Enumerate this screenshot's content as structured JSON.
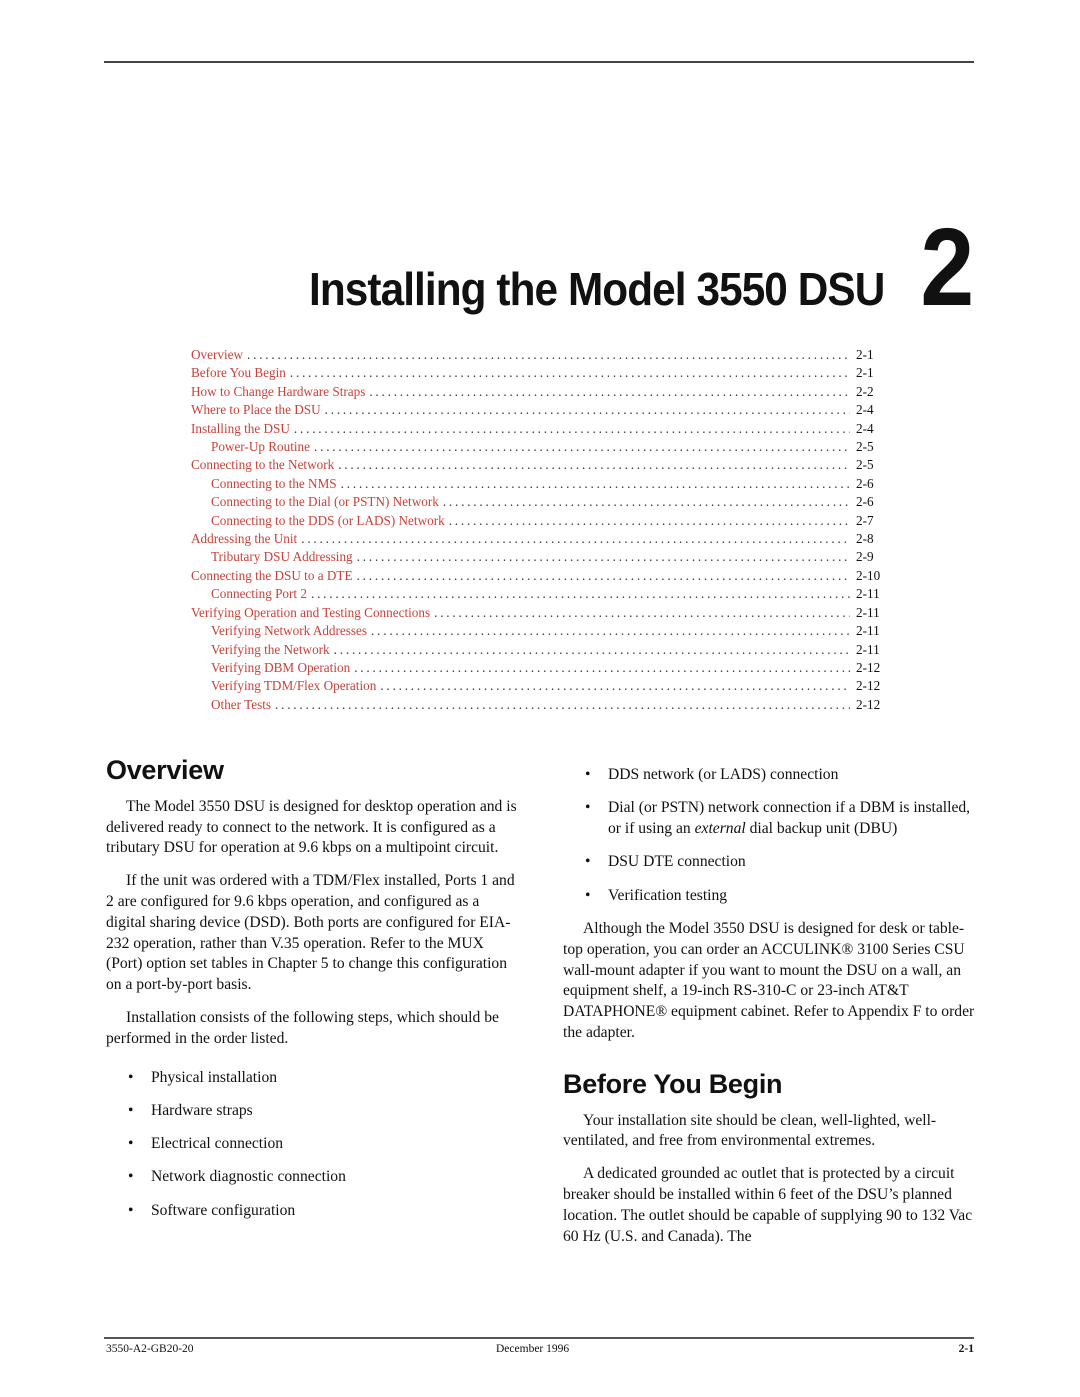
{
  "chapter": {
    "title": "Installing the Model 3550 DSU",
    "number": "2"
  },
  "toc": [
    {
      "label": "Overview",
      "page": "2-1",
      "level": 1
    },
    {
      "label": "Before You Begin",
      "page": "2-1",
      "level": 1
    },
    {
      "label": "How to Change Hardware Straps",
      "page": "2-2",
      "level": 1
    },
    {
      "label": "Where to Place the DSU",
      "page": "2-4",
      "level": 1
    },
    {
      "label": "Installing the DSU",
      "page": "2-4",
      "level": 1
    },
    {
      "label": "Power-Up Routine",
      "page": "2-5",
      "level": 2
    },
    {
      "label": "Connecting to the Network",
      "page": "2-5",
      "level": 1
    },
    {
      "label": "Connecting to the NMS",
      "page": "2-6",
      "level": 2
    },
    {
      "label": "Connecting to the Dial (or PSTN) Network",
      "page": "2-6",
      "level": 2
    },
    {
      "label": "Connecting to the DDS (or LADS) Network",
      "page": "2-7",
      "level": 2
    },
    {
      "label": "Addressing the Unit",
      "page": "2-8",
      "level": 1
    },
    {
      "label": "Tributary DSU Addressing",
      "page": "2-9",
      "level": 2
    },
    {
      "label": "Connecting the DSU to a DTE",
      "page": "2-10",
      "level": 1
    },
    {
      "label": "Connecting Port 2",
      "page": "2-11",
      "level": 2
    },
    {
      "label": "Verifying Operation and Testing Connections",
      "page": "2-11",
      "level": 1
    },
    {
      "label": "Verifying Network Addresses",
      "page": "2-11",
      "level": 2
    },
    {
      "label": "Verifying the Network",
      "page": "2-11",
      "level": 2
    },
    {
      "label": "Verifying DBM Operation",
      "page": "2-12",
      "level": 2
    },
    {
      "label": "Verifying TDM/Flex Operation",
      "page": "2-12",
      "level": 2
    },
    {
      "label": "Other Tests",
      "page": "2-12",
      "level": 2
    }
  ],
  "overview": {
    "heading": "Overview",
    "para1": "The Model 3550 DSU is designed for desktop operation and is delivered ready to connect to the network. It is configured as a tributary DSU for operation at 9.6 kbps on a multipoint circuit.",
    "para2": "If the unit was ordered with a TDM/Flex installed, Ports 1 and 2 are configured for 9.6 kbps operation, and configured as a digital sharing device (DSD). Both ports are configured for EIA-232 operation, rather than V.35 operation. Refer to the MUX (Port) option set tables in Chapter 5 to change this configuration on a port-by-port basis.",
    "para3": "Installation consists of the following steps, which should be performed in the order listed.",
    "steps": [
      "Physical installation",
      "Hardware straps",
      "Electrical connection",
      "Network diagnostic connection",
      "Software configuration",
      "DDS network (or LADS) connection",
      "Dial (or PSTN) network connection if a DBM is installed, or if using an ",
      "DSU DTE connection",
      "Verification testing"
    ],
    "step7_italic": "external",
    "step7_tail": " dial backup unit (DBU)",
    "para4": "Although the Model 3550 DSU is designed for desk or table-top operation, you can order an ACCULINK® 3100 Series CSU wall-mount adapter if you want to mount the DSU on a wall, an equipment shelf, a 19-inch RS-310-C or 23-inch AT&T DATAPHONE® equipment cabinet. Refer to Appendix F to order the adapter."
  },
  "before_you_begin": {
    "heading": "Before You Begin",
    "para1": "Your installation site should be clean, well-lighted, well-ventilated, and free from environmental extremes.",
    "para2": "A dedicated grounded ac outlet that is protected by a circuit breaker should be installed within 6 feet of the DSU’s planned location. The outlet should be capable of supplying 90 to 132 Vac 60 Hz (U.S. and Canada). The"
  },
  "footer": {
    "doc_number": "3550-A2-GB20-20",
    "date": "December 1996",
    "page": "2-1"
  },
  "bullet_glyph": "•",
  "colors": {
    "toc_link": "#c8413a"
  }
}
